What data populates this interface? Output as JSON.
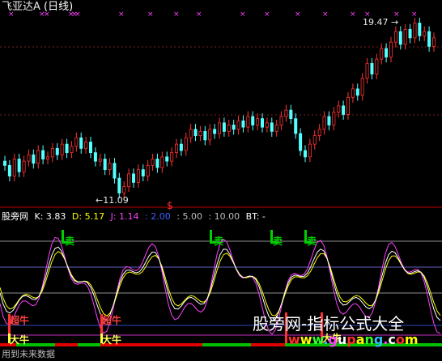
{
  "header": {
    "symbol": "飞亚达A",
    "period": "(日线)"
  },
  "price_panel": {
    "high_label": "19.47",
    "low_label": "11.09",
    "marker": "$"
  },
  "indicator": {
    "name": "股旁网",
    "k": "K: 3.83",
    "d": "D: 5.17",
    "j": "J: 1.14",
    "l1": ": 2.00",
    "l2": ": 5.00",
    "l3": ": 10.00",
    "bt": "BT: -",
    "sell_label": "卖",
    "buy_labels": [
      "超牛",
      "超牛",
      "大牛",
      "大牛",
      "超牛",
      "大牛"
    ]
  },
  "watermark": {
    "text": "股旁网-指标公式大全",
    "url": "www.gupang.com"
  },
  "footer": {
    "text": "用到未来数据"
  },
  "colors": {
    "up": "#ff3232",
    "down": "#54ffff",
    "k": "#ffffff",
    "d": "#ffff00",
    "j": "#ff40ff",
    "sell": "#00d000",
    "band_green": "#00c000",
    "band_red": "#e00000"
  },
  "chart_data": {
    "type": "candlestick",
    "price_range": [
      11.09,
      19.47
    ],
    "closes": [
      12.6,
      12.1,
      12.9,
      12.3,
      12.8,
      13.1,
      12.7,
      13.3,
      12.9,
      13.0,
      13.4,
      13.1,
      13.6,
      13.2,
      13.5,
      13.9,
      13.4,
      13.7,
      13.2,
      12.8,
      12.9,
      12.4,
      12.7,
      12.0,
      11.3,
      11.6,
      12.2,
      11.8,
      12.4,
      12.1,
      12.6,
      12.9,
      12.5,
      13.0,
      12.8,
      13.2,
      13.6,
      13.3,
      13.9,
      14.3,
      14.0,
      14.2,
      13.8,
      14.3,
      14.1,
      14.6,
      14.2,
      14.5,
      14.3,
      14.7,
      14.4,
      14.9,
      14.5,
      14.8,
      14.4,
      14.6,
      14.2,
      14.5,
      14.9,
      15.2,
      14.8,
      14.1,
      13.3,
      13.0,
      13.6,
      14.0,
      14.3,
      14.9,
      14.5,
      15.1,
      15.4,
      15.0,
      15.8,
      16.2,
      15.9,
      16.7,
      17.4,
      16.9,
      17.6,
      18.1,
      17.7,
      18.4,
      18.9,
      18.3,
      19.0,
      18.6,
      19.3,
      18.7,
      18.9,
      18.2,
      18.6
    ]
  }
}
